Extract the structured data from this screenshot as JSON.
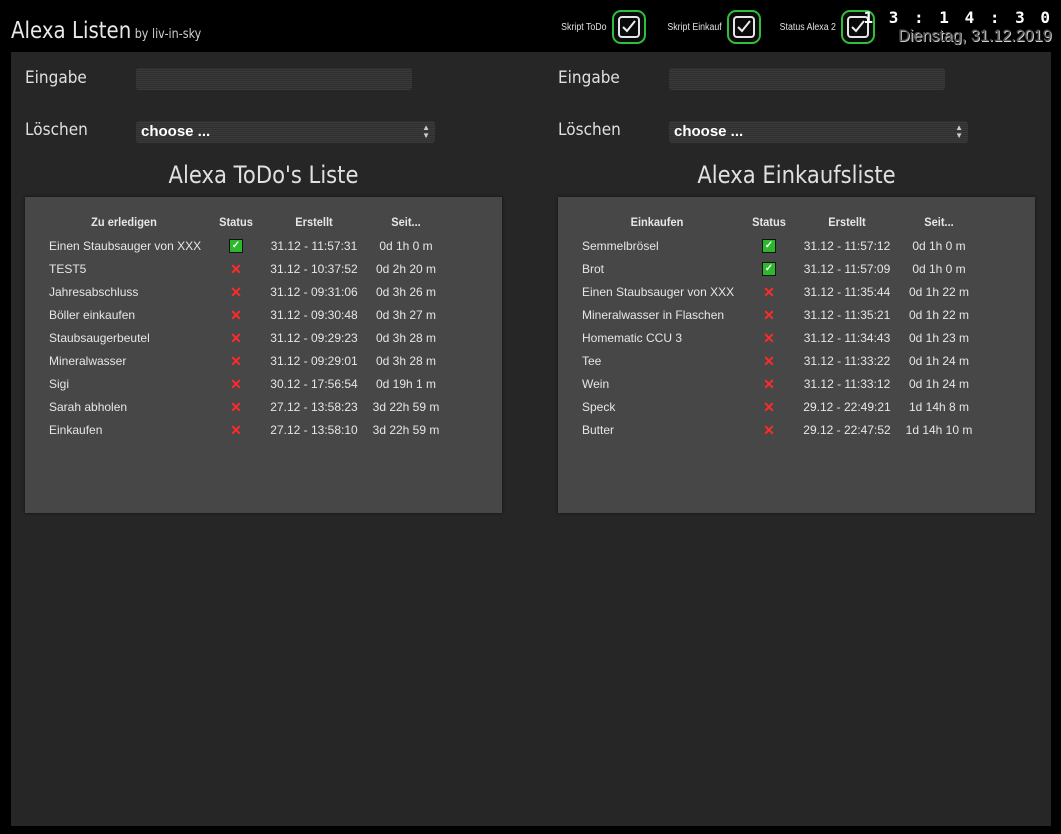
{
  "header": {
    "title": "Alexa Listen",
    "subtitle": "by liv-in-sky",
    "toggles": [
      {
        "label": "Skript ToDo",
        "checked": true
      },
      {
        "label": "Skript Einkauf",
        "checked": true
      },
      {
        "label": "Status Alexa 2",
        "checked": true
      }
    ],
    "time": "13:14:30",
    "date": "Dienstag, 31.12.2019"
  },
  "colors": {
    "accent_green": "#2fbf3a",
    "cross_red": "#ff2a2a",
    "panel": "#474747",
    "background": "#262626"
  },
  "todo": {
    "input_label": "Eingabe",
    "delete_label": "Löschen",
    "delete_select_value": "choose ...",
    "list_title": "Alexa ToDo's Liste",
    "columns": [
      "Zu erledigen",
      "Status",
      "Erstellt",
      "Seit..."
    ],
    "rows": [
      {
        "name": "Einen Staubsauger von XXX",
        "done": true,
        "created": "31.12 - 11:57:31",
        "since": "0d 1h 0 m"
      },
      {
        "name": "TEST5",
        "done": false,
        "created": "31.12 - 10:37:52",
        "since": "0d 2h 20 m"
      },
      {
        "name": "Jahresabschluss",
        "done": false,
        "created": "31.12 - 09:31:06",
        "since": "0d 3h 26 m"
      },
      {
        "name": "Böller einkaufen",
        "done": false,
        "created": "31.12 - 09:30:48",
        "since": "0d 3h 27 m"
      },
      {
        "name": "Staubsaugerbeutel",
        "done": false,
        "created": "31.12 - 09:29:23",
        "since": "0d 3h 28 m"
      },
      {
        "name": "Mineralwasser",
        "done": false,
        "created": "31.12 - 09:29:01",
        "since": "0d 3h 28 m"
      },
      {
        "name": "Sigi",
        "done": false,
        "created": "30.12 - 17:56:54",
        "since": "0d 19h 1 m"
      },
      {
        "name": "Sarah abholen",
        "done": false,
        "created": "27.12 - 13:58:23",
        "since": "3d 22h 59 m"
      },
      {
        "name": "Einkaufen",
        "done": false,
        "created": "27.12 - 13:58:10",
        "since": "3d 22h 59 m"
      }
    ]
  },
  "shopping": {
    "input_label": "Eingabe",
    "delete_label": "Löschen",
    "delete_select_value": "choose ...",
    "list_title": "Alexa Einkaufsliste",
    "columns": [
      "Einkaufen",
      "Status",
      "Erstellt",
      "Seit..."
    ],
    "rows": [
      {
        "name": "Semmelbrösel",
        "done": true,
        "created": "31.12 - 11:57:12",
        "since": "0d 1h 0 m"
      },
      {
        "name": "Brot",
        "done": true,
        "created": "31.12 - 11:57:09",
        "since": "0d 1h 0 m"
      },
      {
        "name": "Einen Staubsauger von XXX",
        "done": false,
        "created": "31.12 - 11:35:44",
        "since": "0d 1h 22 m"
      },
      {
        "name": "Mineralwasser in Flaschen",
        "done": false,
        "created": "31.12 - 11:35:21",
        "since": "0d 1h 22 m"
      },
      {
        "name": "Homematic CCU 3",
        "done": false,
        "created": "31.12 - 11:34:43",
        "since": "0d 1h 23 m"
      },
      {
        "name": "Tee",
        "done": false,
        "created": "31.12 - 11:33:22",
        "since": "0d 1h 24 m"
      },
      {
        "name": "Wein",
        "done": false,
        "created": "31.12 - 11:33:12",
        "since": "0d 1h 24 m"
      },
      {
        "name": "Speck",
        "done": false,
        "created": "29.12 - 22:49:21",
        "since": "1d 14h 8 m"
      },
      {
        "name": "Butter",
        "done": false,
        "created": "29.12 - 22:47:52",
        "since": "1d 14h 10 m"
      }
    ]
  }
}
